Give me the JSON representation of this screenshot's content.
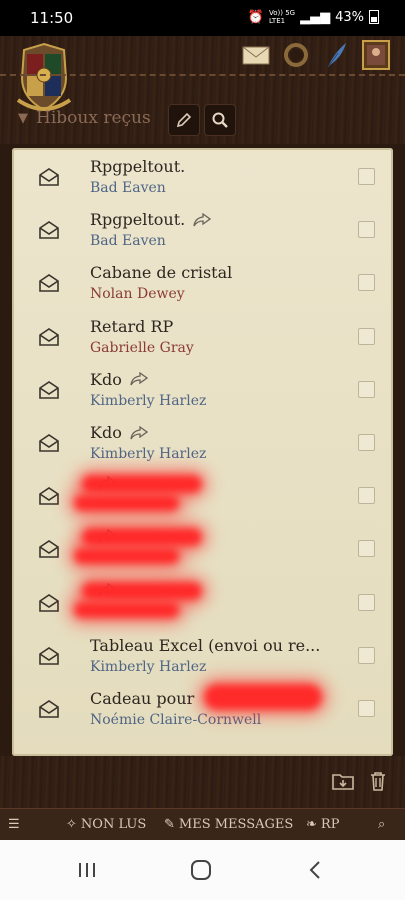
{
  "status": {
    "time": "11:50",
    "network_top": "Vo)) 5G",
    "network_bottom": "LTE1",
    "battery": "43%"
  },
  "header": {
    "folder_label": "Hiboux reçus"
  },
  "messages": [
    {
      "subject": "Rpgpeltout.",
      "author": "Bad Eaven",
      "author_color": "#4e6585",
      "forwarded": false,
      "redacted": false
    },
    {
      "subject": "Rpgpeltout.",
      "author": "Bad Eaven",
      "author_color": "#4e6585",
      "forwarded": true,
      "redacted": false
    },
    {
      "subject": "Cabane de cristal",
      "author": "Nolan Dewey",
      "author_color": "#8a3b36",
      "forwarded": false,
      "redacted": false
    },
    {
      "subject": "Retard RP",
      "author": "Gabrielle Gray",
      "author_color": "#8a3b36",
      "forwarded": false,
      "redacted": false
    },
    {
      "subject": "Kdo",
      "author": "Kimberly Harlez",
      "author_color": "#4e6585",
      "forwarded": true,
      "redacted": false
    },
    {
      "subject": "Kdo",
      "author": "Kimberly Harlez",
      "author_color": "#4e6585",
      "forwarded": true,
      "redacted": false
    },
    {
      "subject": "",
      "author": "",
      "author_color": "#4e6585",
      "forwarded": true,
      "redacted": true
    },
    {
      "subject": "",
      "author": "",
      "author_color": "#4e6585",
      "forwarded": true,
      "redacted": true
    },
    {
      "subject": "",
      "author": "",
      "author_color": "#4e6585",
      "forwarded": true,
      "redacted": true
    },
    {
      "subject": "Tableau Excel (envoi ou re...",
      "author": "Kimberly Harlez",
      "author_color": "#4e6585",
      "forwarded": false,
      "redacted": false
    },
    {
      "subject": "Cadeau pour",
      "author": "Noémie Claire-Cornwell",
      "author_color": "#4e6585",
      "forwarded": false,
      "redacted": false,
      "partial_redaction": true
    }
  ],
  "bottom_nav": {
    "unread": "NON LUS",
    "my_messages": "MES MESSAGES",
    "rp": "RP"
  },
  "icons": [
    "hogwarts-crest-icon",
    "envelope-icon",
    "ring-icon",
    "quill-icon",
    "portrait-icon",
    "pencil-icon",
    "search-icon",
    "folder-move-icon",
    "trash-icon",
    "menu-icon",
    "sparkle-icon"
  ]
}
